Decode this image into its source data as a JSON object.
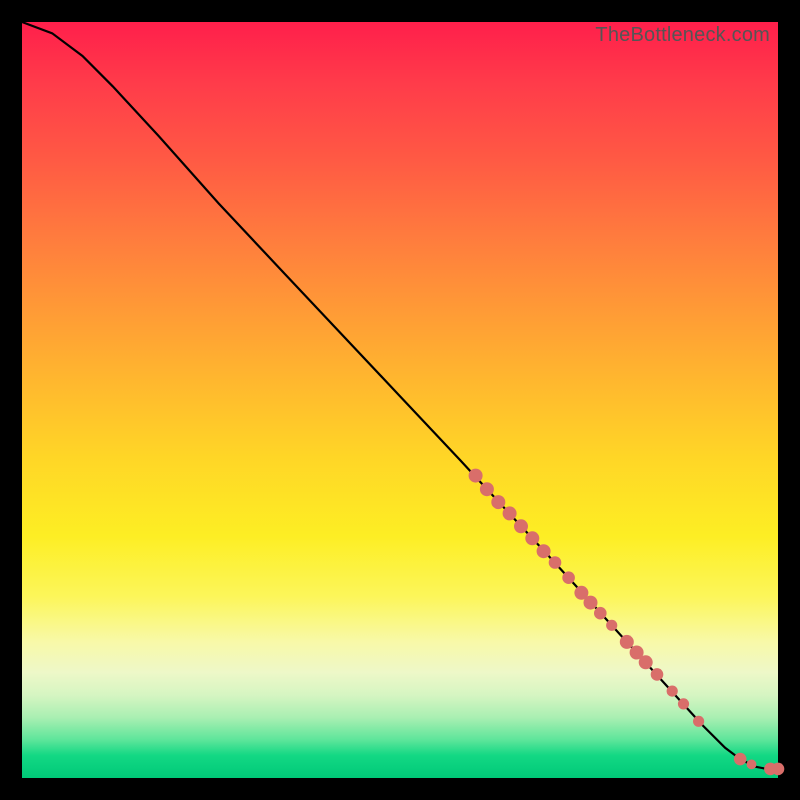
{
  "watermark": "TheBottleneck.com",
  "colors": {
    "marker": "#d96e6a",
    "line": "#000000",
    "bg_black": "#000000"
  },
  "chart_data": {
    "type": "line",
    "title": "",
    "xlabel": "",
    "ylabel": "",
    "xlim": [
      0,
      100
    ],
    "ylim": [
      0,
      100
    ],
    "grid": false,
    "legend": false,
    "series": [
      {
        "name": "curve",
        "x": [
          0,
          4,
          8,
          12,
          18,
          26,
          34,
          42,
          50,
          58,
          64,
          70,
          75,
          80,
          85,
          90,
          93,
          95,
          97,
          98.5,
          100
        ],
        "y": [
          100,
          98.5,
          95.5,
          91.5,
          85,
          76,
          67.5,
          59,
          50.5,
          42,
          35.5,
          29,
          23.5,
          18,
          12.5,
          7,
          4,
          2.5,
          1.5,
          1.2,
          1.2
        ]
      }
    ],
    "markers": [
      {
        "x": 60,
        "y": 40,
        "r": 1.0
      },
      {
        "x": 61.5,
        "y": 38.2,
        "r": 1.0
      },
      {
        "x": 63,
        "y": 36.5,
        "r": 1.0
      },
      {
        "x": 64.5,
        "y": 35,
        "r": 1.0
      },
      {
        "x": 66,
        "y": 33.3,
        "r": 1.0
      },
      {
        "x": 67.5,
        "y": 31.7,
        "r": 1.0
      },
      {
        "x": 69,
        "y": 30,
        "r": 1.0
      },
      {
        "x": 70.5,
        "y": 28.5,
        "r": 0.9
      },
      {
        "x": 72.3,
        "y": 26.5,
        "r": 0.9
      },
      {
        "x": 74,
        "y": 24.5,
        "r": 1.0
      },
      {
        "x": 75.2,
        "y": 23.2,
        "r": 1.0
      },
      {
        "x": 76.5,
        "y": 21.8,
        "r": 0.9
      },
      {
        "x": 78,
        "y": 20.2,
        "r": 0.8
      },
      {
        "x": 80,
        "y": 18,
        "r": 1.0
      },
      {
        "x": 81.3,
        "y": 16.6,
        "r": 1.0
      },
      {
        "x": 82.5,
        "y": 15.3,
        "r": 1.0
      },
      {
        "x": 84,
        "y": 13.7,
        "r": 0.9
      },
      {
        "x": 86,
        "y": 11.5,
        "r": 0.8
      },
      {
        "x": 87.5,
        "y": 9.8,
        "r": 0.8
      },
      {
        "x": 89.5,
        "y": 7.5,
        "r": 0.8
      },
      {
        "x": 95,
        "y": 2.5,
        "r": 0.9
      },
      {
        "x": 96.5,
        "y": 1.8,
        "r": 0.7
      },
      {
        "x": 99,
        "y": 1.2,
        "r": 0.9
      },
      {
        "x": 100,
        "y": 1.2,
        "r": 0.9
      }
    ]
  }
}
